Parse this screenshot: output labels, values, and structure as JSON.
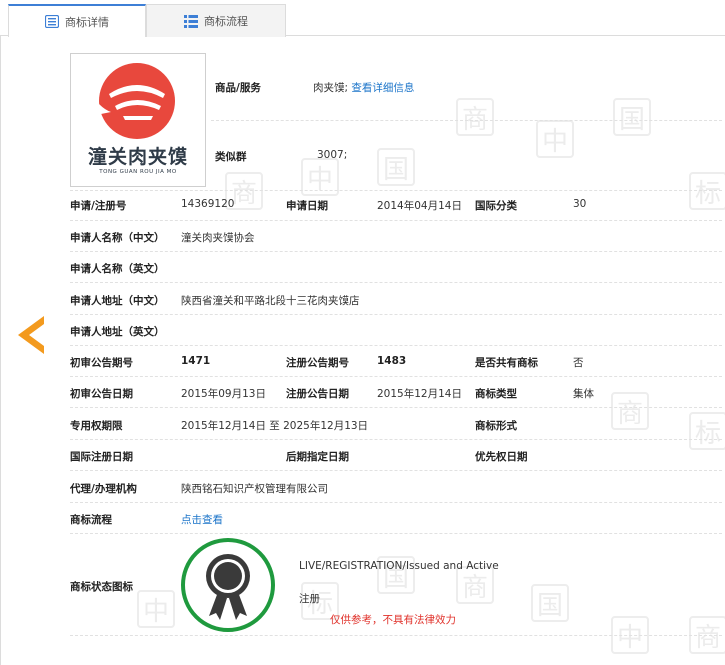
{
  "tabs": [
    {
      "label": "商标详情",
      "active": true,
      "icon": "document-list-icon"
    },
    {
      "label": "商标流程",
      "active": false,
      "icon": "grid-list-icon"
    }
  ],
  "logo": {
    "main_text": "潼关肉夹馍",
    "sub_text": "TONG GUAN ROU JIA MO",
    "colors": {
      "red": "#e8483d",
      "text": "#2f3b48"
    }
  },
  "top": {
    "goods_label": "商品/服务",
    "goods_value": "肉夹馍;",
    "goods_link": "查看详细信息",
    "similar_label": "类似群",
    "similar_value": "3007;"
  },
  "fields": {
    "reg_no_label": "申请/注册号",
    "reg_no_value": "14369120",
    "app_date_label": "申请日期",
    "app_date_value": "2014年04月14日",
    "intl_class_label": "国际分类",
    "intl_class_value": "30",
    "applicant_cn_label": "申请人名称（中文）",
    "applicant_cn_value": "潼关肉夹馍协会",
    "applicant_en_label": "申请人名称（英文）",
    "address_cn_label": "申请人地址（中文）",
    "address_cn_value": "陕西省潼关和平路北段十三花肉夹馍店",
    "address_en_label": "申请人地址（英文）",
    "prelim_no_label": "初审公告期号",
    "prelim_no_value": "1471",
    "reg_ann_no_label": "注册公告期号",
    "reg_ann_no_value": "1483",
    "shared_label": "是否共有商标",
    "shared_value": "否",
    "prelim_date_label": "初审公告日期",
    "prelim_date_value": "2015年09月13日",
    "reg_ann_date_label": "注册公告日期",
    "reg_ann_date_value": "2015年12月14日",
    "type_label": "商标类型",
    "type_value": "集体",
    "term_label": "专用权期限",
    "term_value": "2015年12月14日 至 2025年12月13日",
    "form_label": "商标形式",
    "intl_reg_date_label": "国际注册日期",
    "later_date_label": "后期指定日期",
    "priority_date_label": "优先权日期",
    "agency_label": "代理/办理机构",
    "agency_value": "陕西铭石知识产权管理有限公司",
    "process_label": "商标流程",
    "process_link": "点击查看",
    "status_icon_label": "商标状态图标",
    "status_en": "LIVE/REGISTRATION/Issued and Active",
    "status_cn": "注册"
  },
  "watermark_char": "商",
  "watermark_char2": "中",
  "watermark_char3": "国",
  "watermark_char4": "标",
  "disclaimer": "仅供参考，不具有法律效力",
  "colors": {
    "accent": "#3d7fd6",
    "link": "#1b74c9",
    "arrow": "#f39a1e",
    "badge_ring": "#1f9a3e",
    "disclaimer": "#e0322b"
  }
}
